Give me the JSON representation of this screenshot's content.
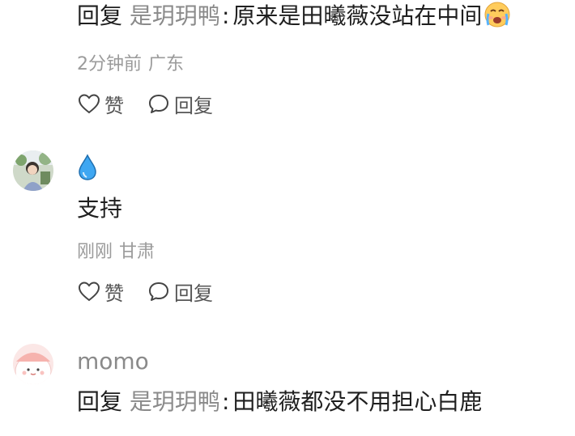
{
  "comments": [
    {
      "reply_prefix": "回复",
      "reply_target": "是玥玥鸭",
      "colon": ":",
      "text": "原来是田曦薇没站在中间",
      "emoji": "crying-face-emoji",
      "time": "2分钟前",
      "location": "广东",
      "like_label": "赞",
      "reply_label": "回复"
    },
    {
      "username_icon": "water-drop-icon",
      "text": "支持",
      "time": "刚刚",
      "location": "甘肃",
      "like_label": "赞",
      "reply_label": "回复"
    },
    {
      "username": "momo",
      "reply_prefix": "回复",
      "reply_target": "是玥玥鸭",
      "colon": ":",
      "text": "田曦薇都没不用担心白鹿"
    }
  ],
  "colors": {
    "text": "#1f1f1f",
    "muted": "#8a8a8a",
    "meta": "#9b9b9b",
    "drop": "#3fa7f2"
  }
}
